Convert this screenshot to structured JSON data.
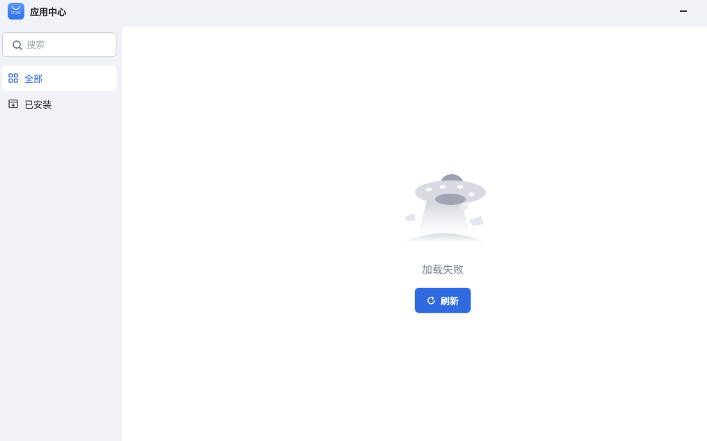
{
  "app": {
    "title": "应用中心",
    "logo_caption": "STORE",
    "accent": "#2f6bde"
  },
  "window": {
    "minimize_icon": "minimize-icon"
  },
  "sidebar": {
    "search": {
      "placeholder": "搜索",
      "value": "",
      "icon": "search-icon"
    },
    "items": [
      {
        "label": "全部",
        "icon": "grid-icon",
        "active": true
      },
      {
        "label": "已安装",
        "icon": "installed-box-icon",
        "active": false
      }
    ]
  },
  "main": {
    "empty_state": {
      "illustration": "ufo-illustration",
      "message": "加载失败",
      "button_label": "刷新",
      "button_icon": "refresh-icon"
    }
  }
}
